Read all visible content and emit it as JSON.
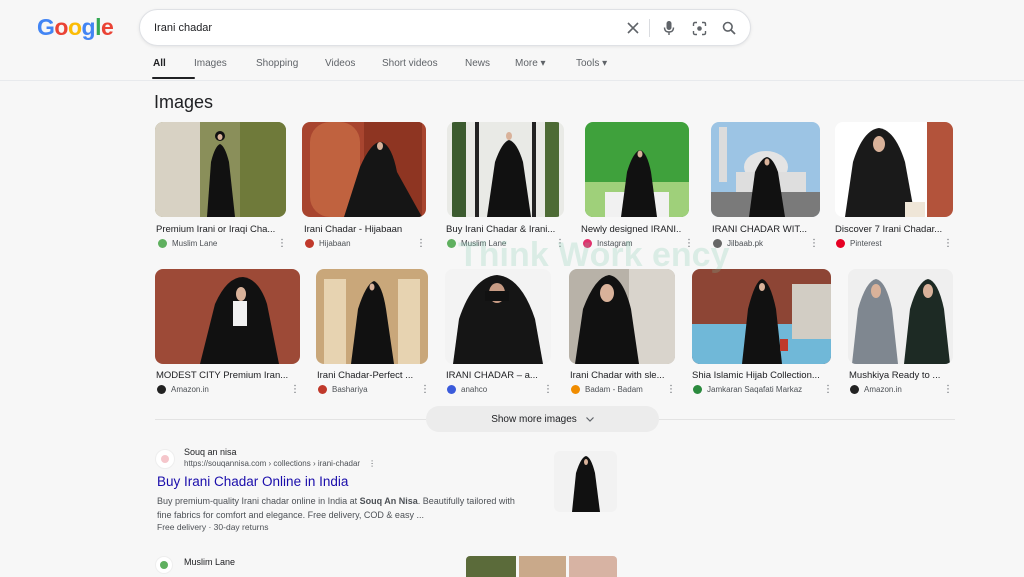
{
  "logo": {
    "letters": [
      "G",
      "o",
      "o",
      "g",
      "l",
      "e"
    ],
    "colors": [
      "#4285f4",
      "#ea4335",
      "#fbbc05",
      "#4285f4",
      "#34a853",
      "#ea4335"
    ]
  },
  "search": {
    "value": "Irani chadar"
  },
  "tabs": [
    {
      "label": "All"
    },
    {
      "label": "Images"
    },
    {
      "label": "Shopping"
    },
    {
      "label": "Videos"
    },
    {
      "label": "Short videos"
    },
    {
      "label": "News"
    },
    {
      "label": "More ▾"
    },
    {
      "label": "Tools ▾"
    }
  ],
  "images_heading": "Images",
  "row1": [
    {
      "caption": "Premium Irani or Iraqi Cha...",
      "source": "Muslim Lane",
      "fav": "#5fb05f"
    },
    {
      "caption": "Irani Chadar - Hijabaan",
      "source": "Hijabaan",
      "fav": "#c0392b"
    },
    {
      "caption": "Buy Irani Chadar & Irani...",
      "source": "Muslim Lane",
      "fav": "#5fb05f"
    },
    {
      "caption": "Newly designed IRANI...",
      "source": "Instagram",
      "fav": "#e1306c"
    },
    {
      "caption": "IRANI CHADAR WIT...",
      "source": "Jilbaab.pk",
      "fav": "#666666"
    },
    {
      "caption": "Discover 7 Irani Chadar...",
      "source": "Pinterest",
      "fav": "#e60023"
    }
  ],
  "row2": [
    {
      "caption": "MODEST CITY Premium Iran...",
      "source": "Amazon.in",
      "fav": "#222222"
    },
    {
      "caption": "Irani Chadar-Perfect ...",
      "source": "Bashariya",
      "fav": "#c0392b"
    },
    {
      "caption": "IRANI CHADAR – a...",
      "source": "anahco",
      "fav": "#3b5bdb"
    },
    {
      "caption": "Irani Chadar with sle...",
      "source": "Badam - Badam",
      "fav": "#f08c00"
    },
    {
      "caption": "Shia Islamic Hijab Collection...",
      "source": "Jamkaran Saqafati Markaz",
      "fav": "#2b8a3e"
    },
    {
      "caption": "Mushkiya Ready to ...",
      "source": "Amazon.in",
      "fav": "#222222"
    }
  ],
  "watermark": "Think Work ency",
  "show_more": "Show more images",
  "result": {
    "site_name": "Souq an nisa",
    "url": "https://souqannisa.com › collections › irani-chadar",
    "title": "Buy Irani Chadar Online in India",
    "snippet_start": "Buy premium-quality Irani chadar online in India at ",
    "snippet_bold": "Souq An Nisa",
    "snippet_end": ". Beautifully tailored with fine fabrics for comfort and elegance. Free delivery, COD & easy ...",
    "meta": "Free delivery · 30-day returns"
  },
  "result2": {
    "site_name": "Muslim Lane"
  }
}
